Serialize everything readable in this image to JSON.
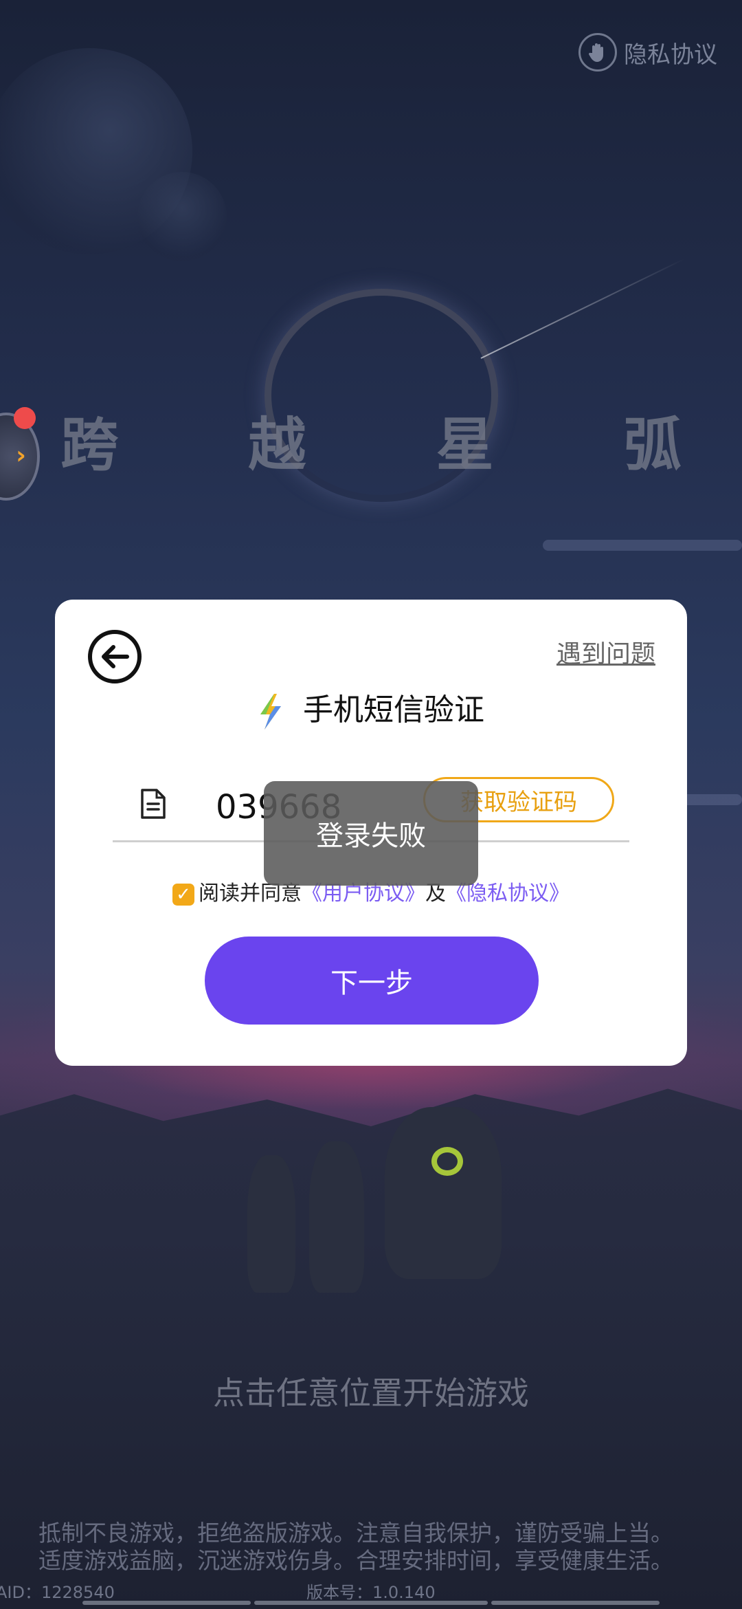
{
  "top_bar": {
    "privacy_label": "隐私协议",
    "privacy_icon": "hand-icon"
  },
  "game": {
    "title": "跨 越 星 弧",
    "start_hint": "点击任意位置开始游戏"
  },
  "side_float": {
    "icon": "chevron-right-icon",
    "badge_color": "#ee4b4b"
  },
  "dialog": {
    "back_icon": "arrow-left-icon",
    "help_label": "遇到问题",
    "title": "手机短信验证",
    "title_icon": "lightning-bolt-icon",
    "code_field_icon": "document-icon",
    "code_value": "039668",
    "get_code_label": "获取验证码",
    "agree_prefix": "阅读并同意",
    "user_agreement": "《用户协议》",
    "agree_and": "及",
    "privacy_agreement": "《隐私协议》",
    "agree_checked": true,
    "next_label": "下一步",
    "accent_color": "#6a44ee",
    "highlight_color": "#f2a818"
  },
  "toast": {
    "message": "登录失败"
  },
  "footer": {
    "notice_line1": "抵制不良游戏，拒绝盗版游戏。注意自我保护，谨防受骗上当。",
    "notice_line2": "适度游戏益脑，沉迷游戏伤身。合理安排时间，享受健康生活。",
    "aid": "AID：1228540",
    "version": "版本号：1.0.140"
  }
}
